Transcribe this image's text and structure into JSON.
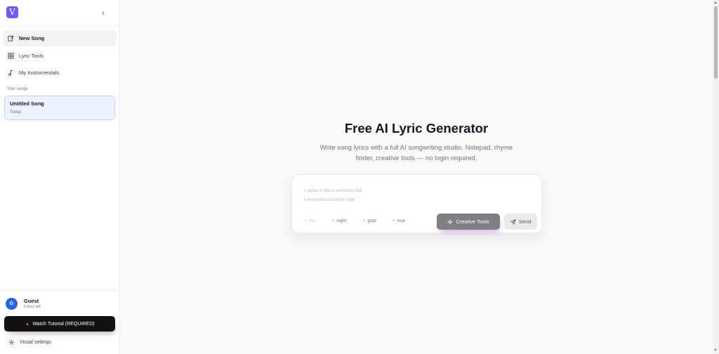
{
  "sidebar": {
    "logo_letter": "V",
    "collapse_glyph": "‹",
    "nav": [
      {
        "label": "New Song",
        "icon": "edit-icon",
        "active": true
      },
      {
        "label": "Lyric Tools",
        "icon": "grid-icon",
        "active": false
      },
      {
        "label": "My Instrumentals",
        "icon": "music-note-icon",
        "active": false
      }
    ],
    "section_label": "Your songs",
    "songs": [
      {
        "title": "Untitled Song",
        "date": "Today"
      }
    ],
    "user": {
      "initial": "G",
      "name": "Guest",
      "sub": "5 tries left"
    },
    "tutorial_label": "Watch Tutorial (REQUIRED)",
    "tutorial_icon": "warning-icon",
    "visual_settings_label": "Visual settings"
  },
  "main": {
    "title": "Free AI Lyric Generator",
    "subtitle": "Write song lyrics with a full AI songwriting studio. Notepad, rhyme finder, creative tools — no login required.",
    "composer": {
      "placeholder": "I came in like a wrecking ball\nI never hit so hard in love",
      "chips": [
        "fire",
        "night",
        "gold",
        "real"
      ],
      "creative_label": "Creative Tools",
      "send_label": "Send"
    }
  },
  "colors": {
    "brand": "#6d5df4",
    "avatar": "#2563eb",
    "active_song_bg": "#eef4ff",
    "tutorial_bg": "#111111"
  }
}
